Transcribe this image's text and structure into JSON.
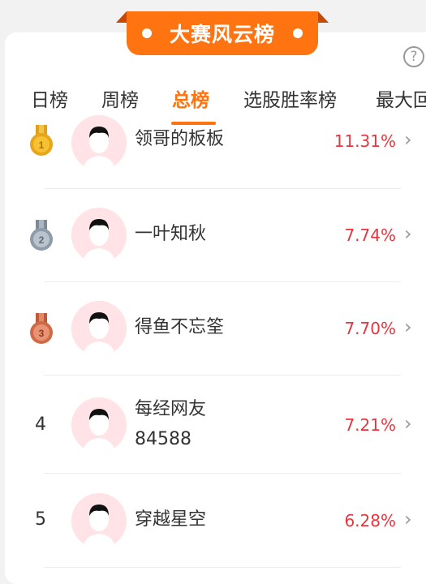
{
  "banner": {
    "title": "大赛风云榜"
  },
  "help_icon": "?",
  "tabs": [
    {
      "label": "日榜"
    },
    {
      "label": "周榜"
    },
    {
      "label": "总榜"
    },
    {
      "label": "选股胜率榜"
    },
    {
      "label": "最大回"
    }
  ],
  "active_tab": "总榜",
  "rows": [
    {
      "rank": "1",
      "medal": "gold",
      "name": "领哥的板板",
      "pct": "11.31%"
    },
    {
      "rank": "2",
      "medal": "silver",
      "name": "一叶知秋",
      "pct": "7.74%"
    },
    {
      "rank": "3",
      "medal": "bronze",
      "name": "得鱼不忘筌",
      "pct": "7.70%"
    },
    {
      "rank": "4",
      "name_line1": "每经网友",
      "name_line2": "84588",
      "pct": "7.21%"
    },
    {
      "rank": "5",
      "name": "穿越星空",
      "pct": "6.28%"
    }
  ],
  "chevron": "›",
  "colors": {
    "accent": "#ff7310",
    "positive": "#e8353e"
  }
}
